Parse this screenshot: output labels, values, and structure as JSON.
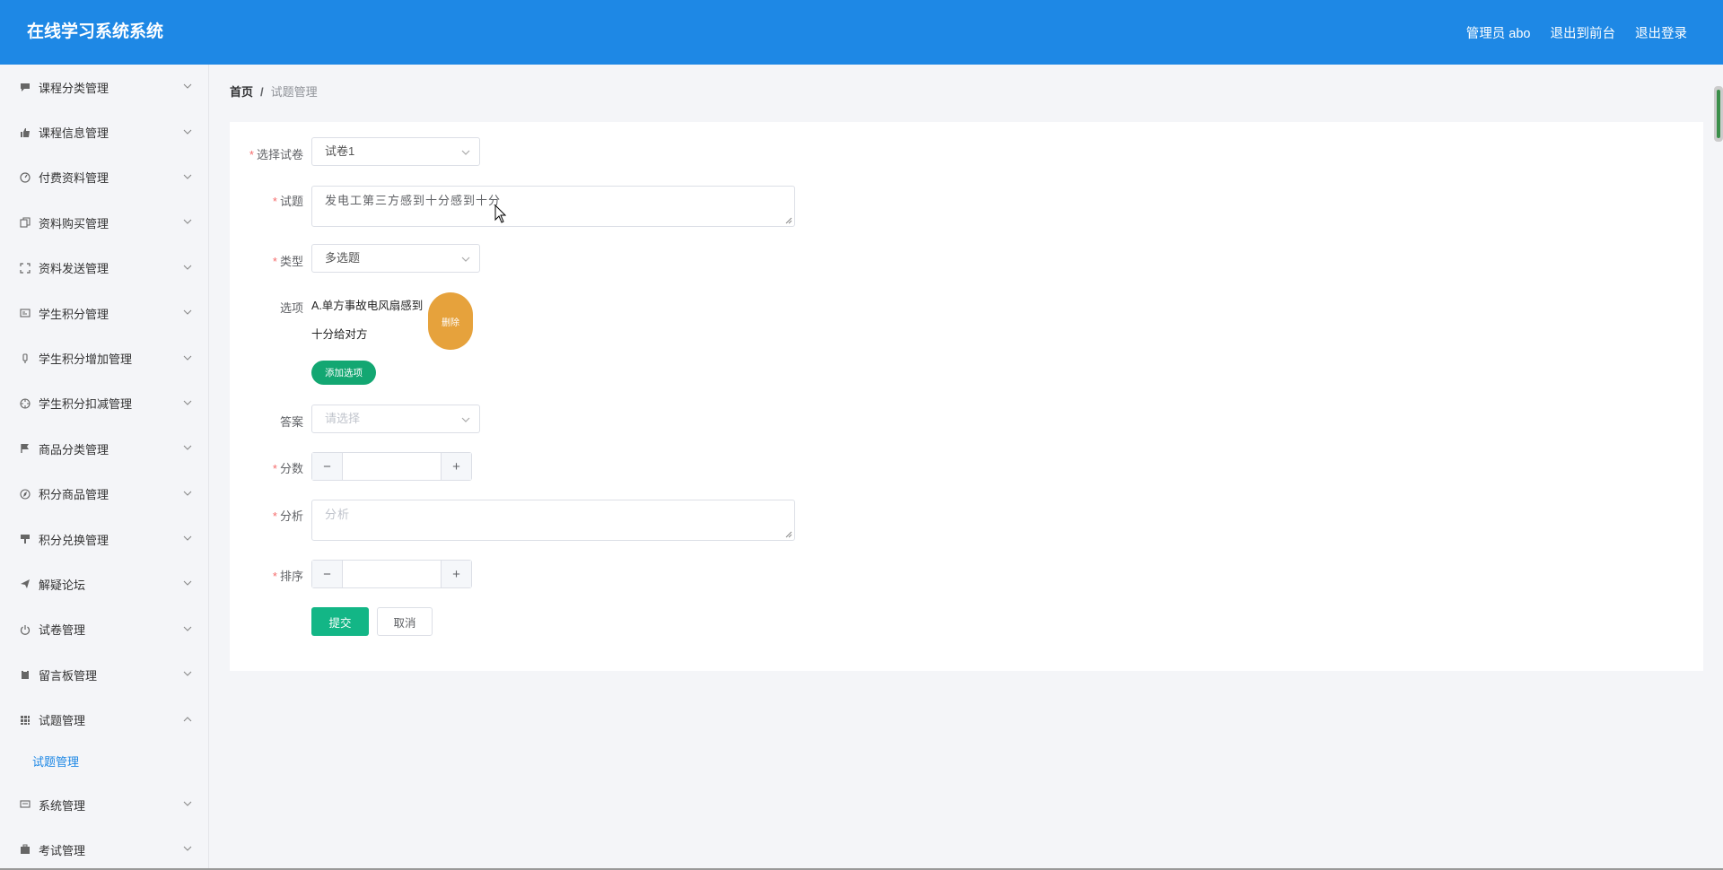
{
  "header": {
    "title": "在线学习系统系统",
    "links": [
      "管理员 abo",
      "退出到前台",
      "退出登录"
    ]
  },
  "sidebar": {
    "items": [
      {
        "label": "课程分类管理",
        "icon": "chat-bubble-icon"
      },
      {
        "label": "课程信息管理",
        "icon": "thumbs-up-icon"
      },
      {
        "label": "付费资料管理",
        "icon": "gauge-icon"
      },
      {
        "label": "资料购买管理",
        "icon": "copy-icon"
      },
      {
        "label": "资料发送管理",
        "icon": "fullscreen-icon"
      },
      {
        "label": "学生积分管理",
        "icon": "id-card-icon"
      },
      {
        "label": "学生积分增加管理",
        "icon": "pin-icon"
      },
      {
        "label": "学生积分扣减管理",
        "icon": "crosshair-icon"
      },
      {
        "label": "商品分类管理",
        "icon": "flag-icon"
      },
      {
        "label": "积分商品管理",
        "icon": "compass-icon"
      },
      {
        "label": "积分兑换管理",
        "icon": "stamp-icon"
      },
      {
        "label": "解疑论坛",
        "icon": "paper-plane-icon"
      },
      {
        "label": "试卷管理",
        "icon": "power-icon"
      },
      {
        "label": "留言板管理",
        "icon": "clipboard-icon"
      },
      {
        "label": "试题管理",
        "icon": "grid-icon",
        "expanded": true,
        "children": [
          "试题管理"
        ]
      },
      {
        "label": "系统管理",
        "icon": "message-icon"
      },
      {
        "label": "考试管理",
        "icon": "briefcase-icon"
      }
    ]
  },
  "breadcrumb": {
    "home": "首页",
    "separator": "/",
    "current": "试题管理"
  },
  "form": {
    "paper": {
      "label": "选择试卷",
      "value": "试卷1"
    },
    "question": {
      "label": "试题",
      "value": "发电工第三方感到十分感到十分"
    },
    "type": {
      "label": "类型",
      "value": "多选题"
    },
    "options": {
      "label": "选项",
      "option_line1": "A.单方事故电风扇感到",
      "option_line2": "十分给对方",
      "delete_label": "删除",
      "add_label": "添加选项"
    },
    "answer": {
      "label": "答案",
      "placeholder": "请选择"
    },
    "score": {
      "label": "分数",
      "minus": "−",
      "plus": "+"
    },
    "analysis": {
      "label": "分析",
      "placeholder": "分析"
    },
    "sort": {
      "label": "排序",
      "minus": "−",
      "plus": "+"
    },
    "submit_label": "提交",
    "cancel_label": "取消"
  },
  "colors": {
    "header": "#1e88e5",
    "active_menu": "#1e88e5",
    "delete_button": "#e6a23c",
    "add_button": "#13a772",
    "submit_button": "#13b686",
    "required_mark": "#f56c6c"
  }
}
